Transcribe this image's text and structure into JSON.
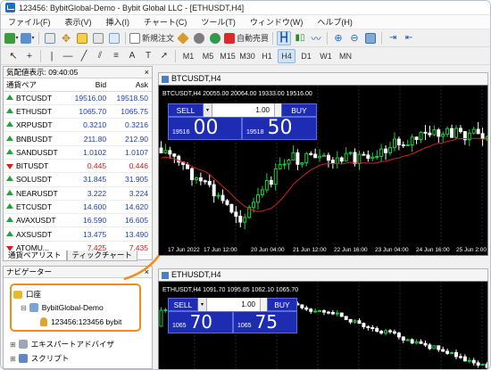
{
  "window": {
    "title": "123456: BybitGlobal-Demo - Bybit Global LLC - [ETHUSDT,H4]"
  },
  "menu": [
    "ファイル(F)",
    "表示(V)",
    "挿入(I)",
    "チャート(C)",
    "ツール(T)",
    "ウィンドウ(W)",
    "ヘルプ(H)"
  ],
  "toolbar": {
    "new_order_label": "新規注文",
    "autotrade_label": "自動売買"
  },
  "timeframes": [
    "M1",
    "M5",
    "M15",
    "M30",
    "H1",
    "H4",
    "D1",
    "W1",
    "MN"
  ],
  "active_timeframe": "H4",
  "market_watch": {
    "title": "気配値表示: 09:40:05",
    "col_symbol": "通貨ペア",
    "col_bid": "Bid",
    "col_ask": "Ask",
    "rows": [
      {
        "symbol": "BTCUSDT",
        "bid": "19516.00",
        "ask": "19518.50",
        "dir": "up"
      },
      {
        "symbol": "ETHUSDT",
        "bid": "1065.70",
        "ask": "1065.75",
        "dir": "up"
      },
      {
        "symbol": "XRPUSDT",
        "bid": "0.3210",
        "ask": "0.3216",
        "dir": "up"
      },
      {
        "symbol": "BNBUSDT",
        "bid": "211.80",
        "ask": "212.90",
        "dir": "up"
      },
      {
        "symbol": "SANDUSDT",
        "bid": "1.0102",
        "ask": "1.0107",
        "dir": "up"
      },
      {
        "symbol": "BITUSDT",
        "bid": "0.445",
        "ask": "0.446",
        "dir": "down"
      },
      {
        "symbol": "SOLUSDT",
        "bid": "31.845",
        "ask": "31.905",
        "dir": "up"
      },
      {
        "symbol": "NEARUSDT",
        "bid": "3.222",
        "ask": "3.224",
        "dir": "up"
      },
      {
        "symbol": "ETCUSDT",
        "bid": "14.600",
        "ask": "14.620",
        "dir": "up"
      },
      {
        "symbol": "AVAXUSDT",
        "bid": "16.590",
        "ask": "16.605",
        "dir": "up"
      },
      {
        "symbol": "AXSUSDT",
        "bid": "13.475",
        "ask": "13.490",
        "dir": "up"
      },
      {
        "symbol": "ATOMU...",
        "bid": "7.425",
        "ask": "7.435",
        "dir": "down"
      }
    ],
    "tabs": [
      "通貨ペアリスト",
      "ティックチャート"
    ]
  },
  "navigator": {
    "title": "ナビゲーター",
    "account_label": "口座",
    "server_label": "BybitGlobal-Demo",
    "account_id": "123456:123456 bybit",
    "item_ea": "エキスパートアドバイザ",
    "item_script": "スクリプト"
  },
  "charts": [
    {
      "name": "BTCUSDT,H4",
      "ohlc": "BTCUSDT,H4  20055.00 20064.00 19333.00 19516.00",
      "sell": "SELL",
      "buy": "BUY",
      "lot": "1.00",
      "bid_prefix": "19516",
      "bid_big": "00",
      "ask_prefix": "19518",
      "ask_big": "50",
      "time_labels": [
        "17 Jun 2022",
        "17 Jun 12:00",
        "20 Jun 04:00",
        "21 Jun 12:00",
        "22 Jun 16:00",
        "23 Jun 04:00",
        "24 Jun 16:00",
        "25 Jun 2:00",
        "27 Jun 04:00"
      ]
    },
    {
      "name": "ETHUSDT,H4",
      "ohlc": "ETHUSDT,H4  1091.70 1095.85 1062.10 1065.70",
      "sell": "SELL",
      "buy": "BUY",
      "lot": "1.00",
      "bid_prefix": "1065",
      "bid_big": "70",
      "ask_prefix": "1065",
      "ask_big": "75"
    }
  ]
}
